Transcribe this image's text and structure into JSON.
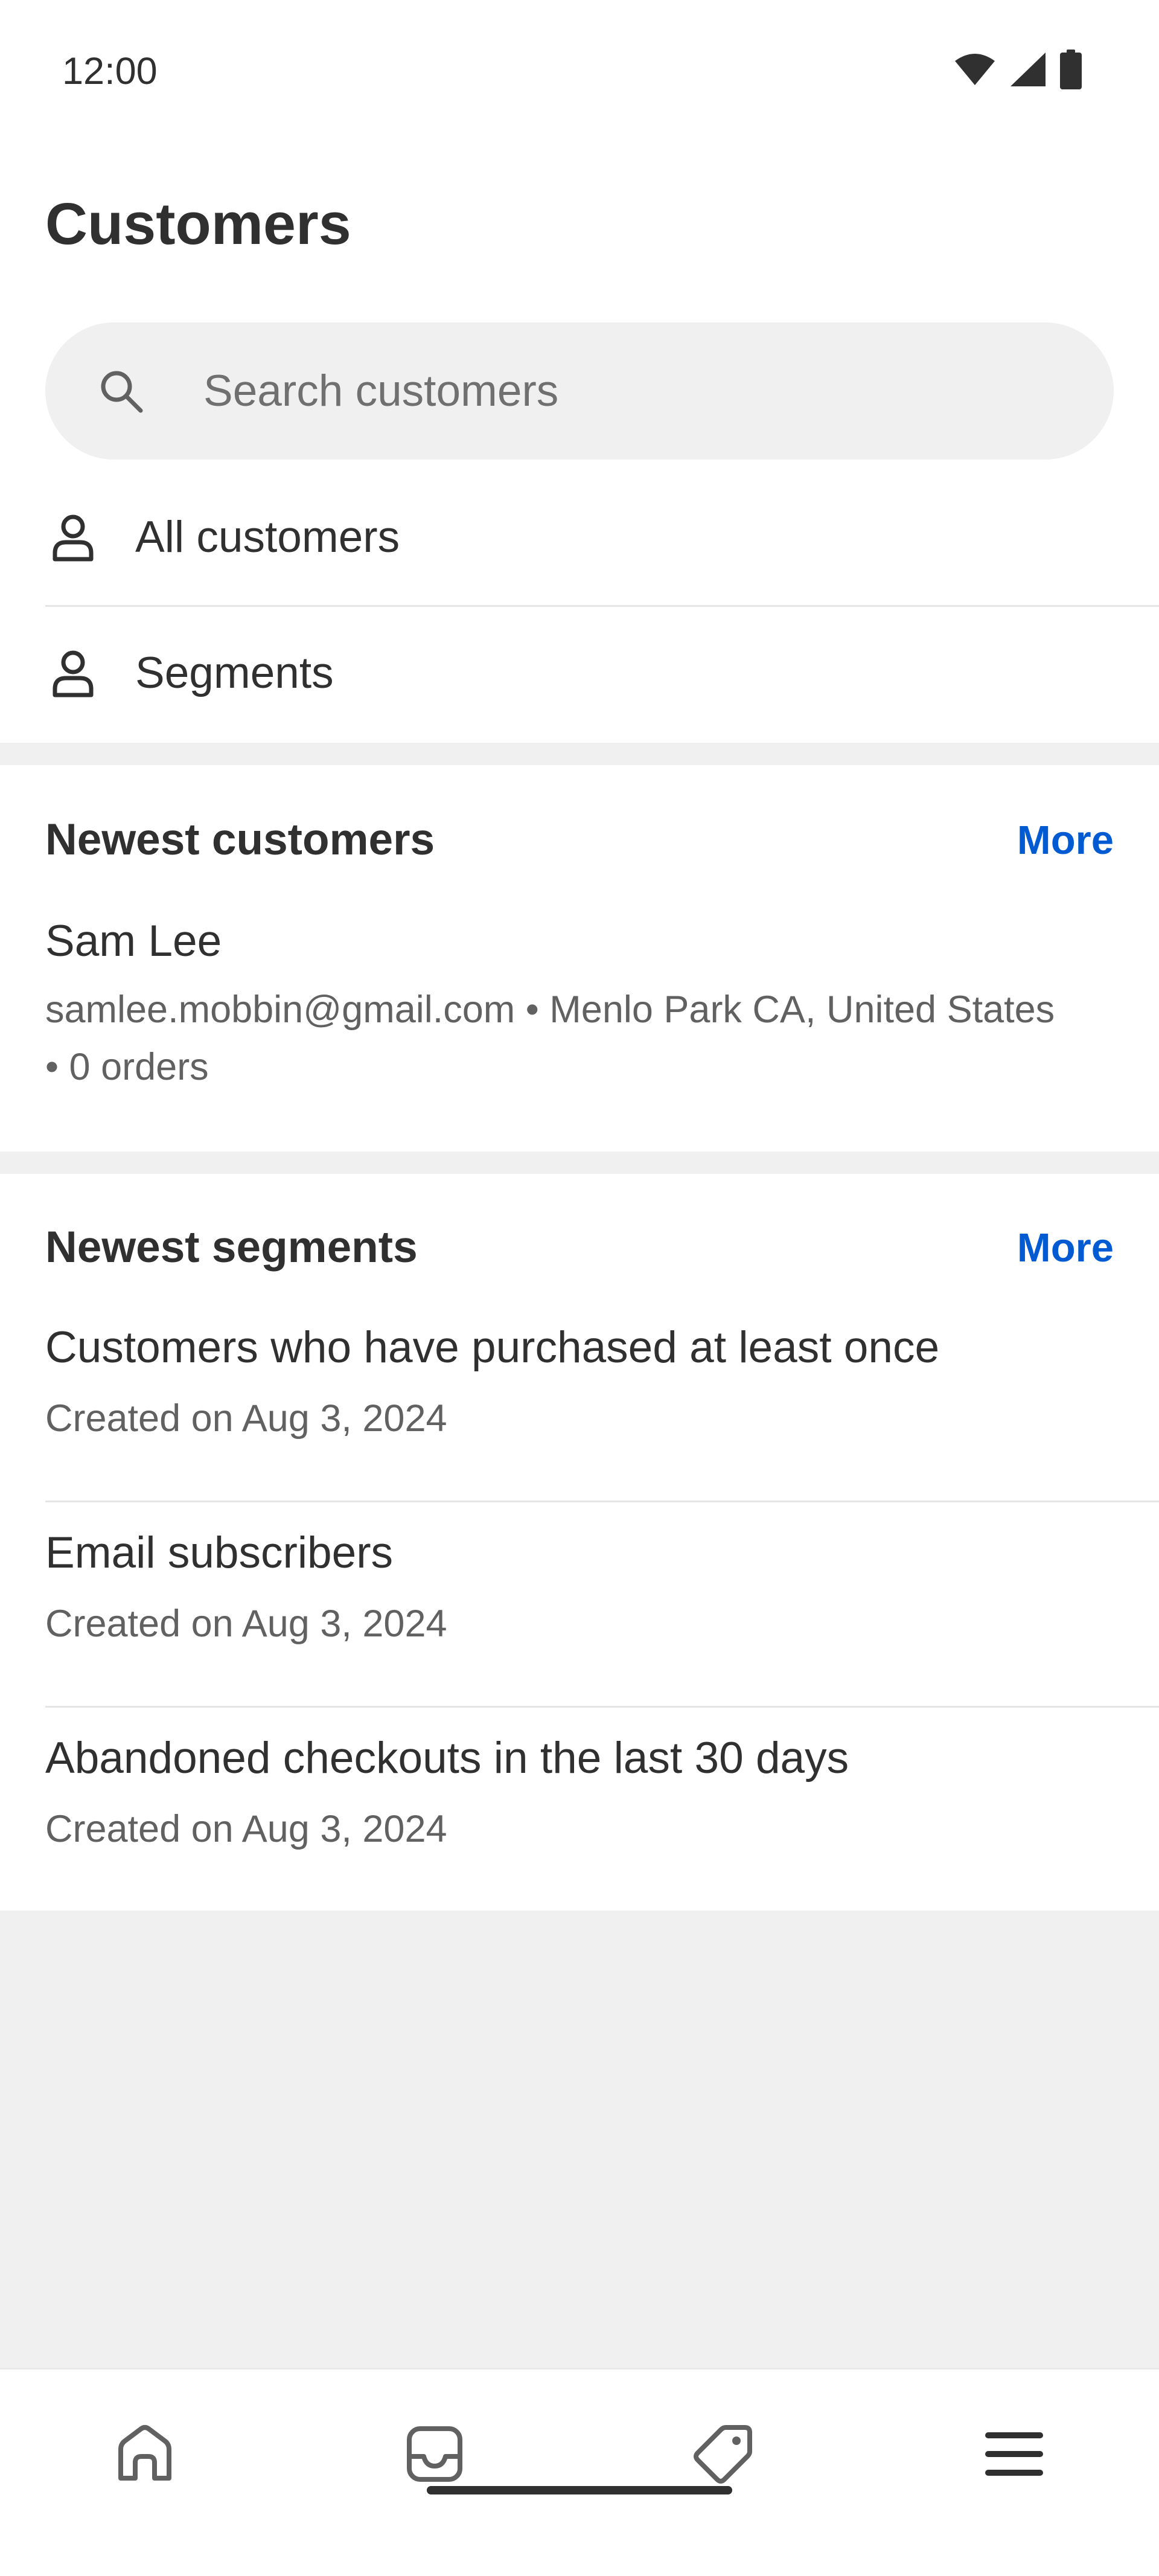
{
  "status_bar": {
    "time": "12:00",
    "icons": [
      "wifi-icon",
      "signal-icon",
      "battery-icon"
    ]
  },
  "page": {
    "title": "Customers"
  },
  "search": {
    "placeholder": "Search customers",
    "value": "",
    "icon": "search-icon"
  },
  "nav_rows": [
    {
      "label": "All customers",
      "icon": "person-icon"
    },
    {
      "label": "Segments",
      "icon": "person-icon"
    }
  ],
  "newest_customers": {
    "title": "Newest customers",
    "more_label": "More",
    "items": [
      {
        "name": "Sam Lee",
        "details": "samlee.mobbin@gmail.com • Menlo Park CA, United States • 0 orders"
      }
    ]
  },
  "newest_segments": {
    "title": "Newest segments",
    "more_label": "More",
    "items": [
      {
        "name": "Customers who have purchased at least once",
        "created": "Created on Aug 3, 2024"
      },
      {
        "name": "Email subscribers",
        "created": "Created on Aug 3, 2024"
      },
      {
        "name": "Abandoned checkouts in the last 30 days",
        "created": "Created on Aug 3, 2024"
      }
    ]
  },
  "bottom_nav": {
    "tabs": [
      "home-icon",
      "inbox-icon",
      "tag-icon",
      "menu-icon"
    ]
  },
  "colors": {
    "accent": "#005bd3",
    "text": "#303030",
    "secondary_text": "#616161",
    "background_band": "#f0f0f0"
  }
}
